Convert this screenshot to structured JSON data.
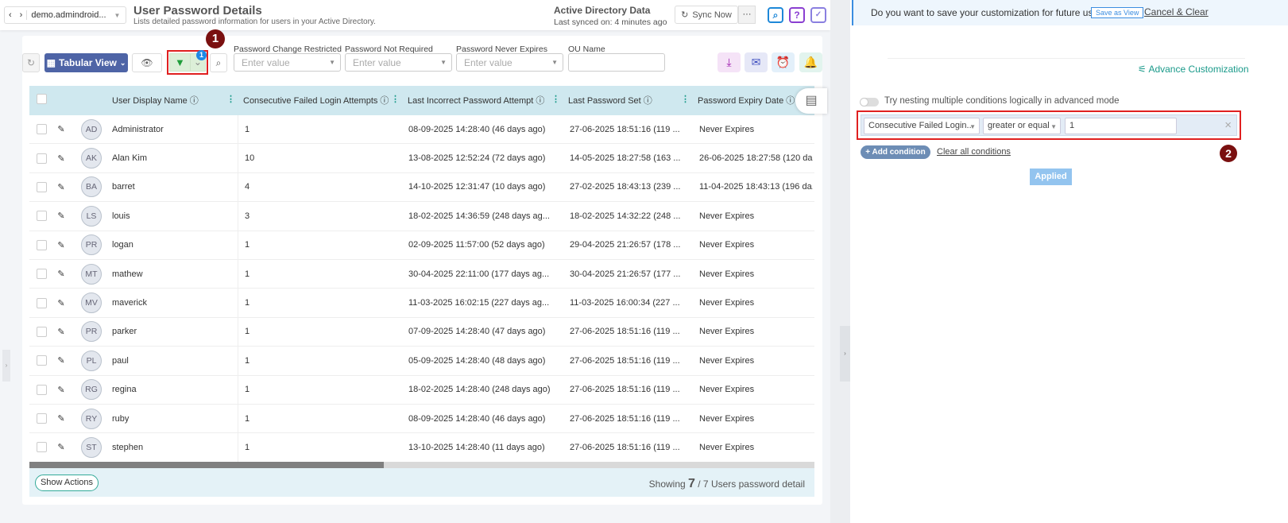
{
  "header": {
    "tenant": "demo.admindroid...",
    "title": "User Password Details",
    "subtitle": "Lists detailed password information for users in your Active Directory.",
    "ad_title": "Active Directory Data",
    "last_synced": "Last synced on: 4 minutes ago",
    "sync_label": "Sync Now",
    "more_label": "···",
    "help_label": "?"
  },
  "toolbar": {
    "view_label": "Tabular View",
    "filter_count": "1",
    "callout_1": "1",
    "filters": [
      {
        "label": "Password Change Restricted",
        "placeholder": "Enter value"
      },
      {
        "label": "Password Not Required",
        "placeholder": "Enter value"
      },
      {
        "label": "Password Never Expires",
        "placeholder": "Enter value"
      },
      {
        "label": "OU Name",
        "value": ""
      }
    ]
  },
  "table": {
    "columns": [
      "User Display Name",
      "Consecutive Failed Login Attempts",
      "Last Incorrect Password Attempt",
      "Last Password Set",
      "Password Expiry Date"
    ],
    "rows": [
      [
        "AD",
        "Administrator",
        "1",
        "08-09-2025 14:28:40 (46 days ago)",
        "27-06-2025 18:51:16 (119 ...",
        "Never Expires"
      ],
      [
        "AK",
        "Alan Kim",
        "10",
        "13-08-2025 12:52:24 (72 days ago)",
        "14-05-2025 18:27:58 (163 ...",
        "26-06-2025 18:27:58 (120 da..."
      ],
      [
        "BA",
        "barret",
        "4",
        "14-10-2025 12:31:47 (10 days ago)",
        "27-02-2025 18:43:13 (239 ...",
        "11-04-2025 18:43:13 (196 da..."
      ],
      [
        "LS",
        "louis",
        "3",
        "18-02-2025 14:36:59 (248 days ag...",
        "18-02-2025 14:32:22 (248 ...",
        "Never Expires"
      ],
      [
        "PR",
        "logan",
        "1",
        "02-09-2025 11:57:00 (52 days ago)",
        "29-04-2025 21:26:57 (178 ...",
        "Never Expires"
      ],
      [
        "MT",
        "mathew",
        "1",
        "30-04-2025 22:11:00 (177 days ag...",
        "30-04-2025 21:26:57 (177 ...",
        "Never Expires"
      ],
      [
        "MV",
        "maverick",
        "1",
        "11-03-2025 16:02:15 (227 days ag...",
        "11-03-2025 16:00:34 (227 ...",
        "Never Expires"
      ],
      [
        "PR",
        "parker",
        "1",
        "07-09-2025 14:28:40 (47 days ago)",
        "27-06-2025 18:51:16 (119 ...",
        "Never Expires"
      ],
      [
        "PL",
        "paul",
        "1",
        "05-09-2025 14:28:40 (48 days ago)",
        "27-06-2025 18:51:16 (119 ...",
        "Never Expires"
      ],
      [
        "RG",
        "regina",
        "1",
        "18-02-2025 14:28:40 (248 days ago)",
        "27-06-2025 18:51:16 (119 ...",
        "Never Expires"
      ],
      [
        "RY",
        "ruby",
        "1",
        "08-09-2025 14:28:40 (46 days ago)",
        "27-06-2025 18:51:16 (119 ...",
        "Never Expires"
      ],
      [
        "ST",
        "stephen",
        "1",
        "13-10-2025 14:28:40 (11 days ago)",
        "27-06-2025 18:51:16 (119 ...",
        "Never Expires"
      ]
    ]
  },
  "footer": {
    "show_actions": "Show Actions",
    "showing_prefix": "Showing",
    "showing_count": "7",
    "showing_suffix": "/ 7 Users password detail"
  },
  "panel": {
    "save_question": "Do you want to save your customization for future use?",
    "save_as_view": "Save as View",
    "cancel_clear": "Cancel & Clear",
    "advance": "Advance Customization",
    "nesting_toggle": "Try nesting multiple conditions logically in advanced mode",
    "condition": {
      "field": "Consecutive Failed Login...",
      "operator": "greater or equal",
      "value": "1"
    },
    "add_condition": "+ Add condition",
    "clear_all": "Clear all conditions",
    "applied": "Applied",
    "callout_2": "2"
  }
}
